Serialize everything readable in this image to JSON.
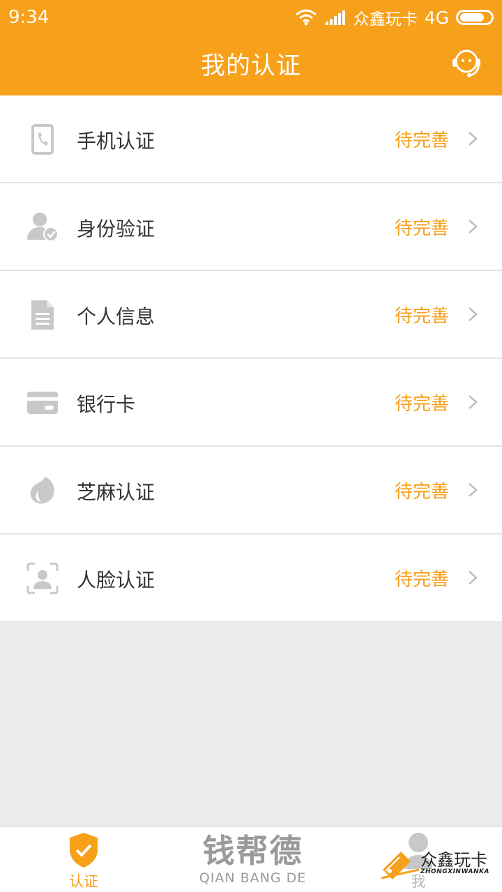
{
  "status_bar": {
    "time": "9:34",
    "carrier": "众鑫玩卡",
    "network": "4G"
  },
  "header": {
    "title": "我的认证",
    "support_icon": "customer-service-icon"
  },
  "items": [
    {
      "label": "手机认证",
      "status": "待完善",
      "icon": "phone-icon"
    },
    {
      "label": "身份验证",
      "status": "待完善",
      "icon": "user-verified-icon"
    },
    {
      "label": "个人信息",
      "status": "待完善",
      "icon": "document-icon"
    },
    {
      "label": "银行卡",
      "status": "待完善",
      "icon": "bank-card-icon"
    },
    {
      "label": "芝麻认证",
      "status": "待完善",
      "icon": "sesame-icon"
    },
    {
      "label": "人脸认证",
      "status": "待完善",
      "icon": "face-scan-icon"
    }
  ],
  "tabbar": {
    "auth_label": "认证",
    "me_label": "我"
  },
  "watermarks": {
    "center_cn": "钱帮德",
    "center_en": "QIAN BANG DE",
    "right_cn": "众鑫玩卡",
    "right_en": "ZHONGXINWANKA"
  },
  "colors": {
    "accent": "#f7a01a",
    "icon_gray": "#c8c8c8",
    "background": "#ebebeb"
  }
}
